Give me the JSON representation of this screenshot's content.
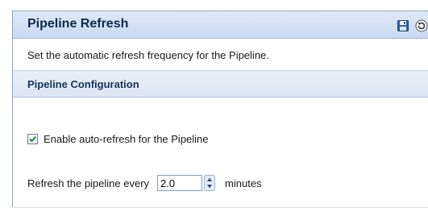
{
  "header": {
    "title": "Pipeline Refresh",
    "icons": [
      "save-icon",
      "refresh-icon"
    ]
  },
  "description": "Set the automatic refresh frequency for the Pipeline.",
  "section": {
    "title": "Pipeline Configuration"
  },
  "auto_refresh": {
    "label": "Enable auto-refresh for the Pipeline",
    "checked": true
  },
  "refresh_interval": {
    "prefix_label": "Refresh the pipeline every",
    "value": "2.0",
    "units_label": "minutes"
  },
  "colors": {
    "title_text": "#0d2a4d",
    "title_bar_top": "#dfe9f7",
    "title_bar_bottom": "#c9daf0",
    "section_bar": "#dbe6f4",
    "border": "#8aa6c8",
    "check": "#1c8a2e"
  }
}
